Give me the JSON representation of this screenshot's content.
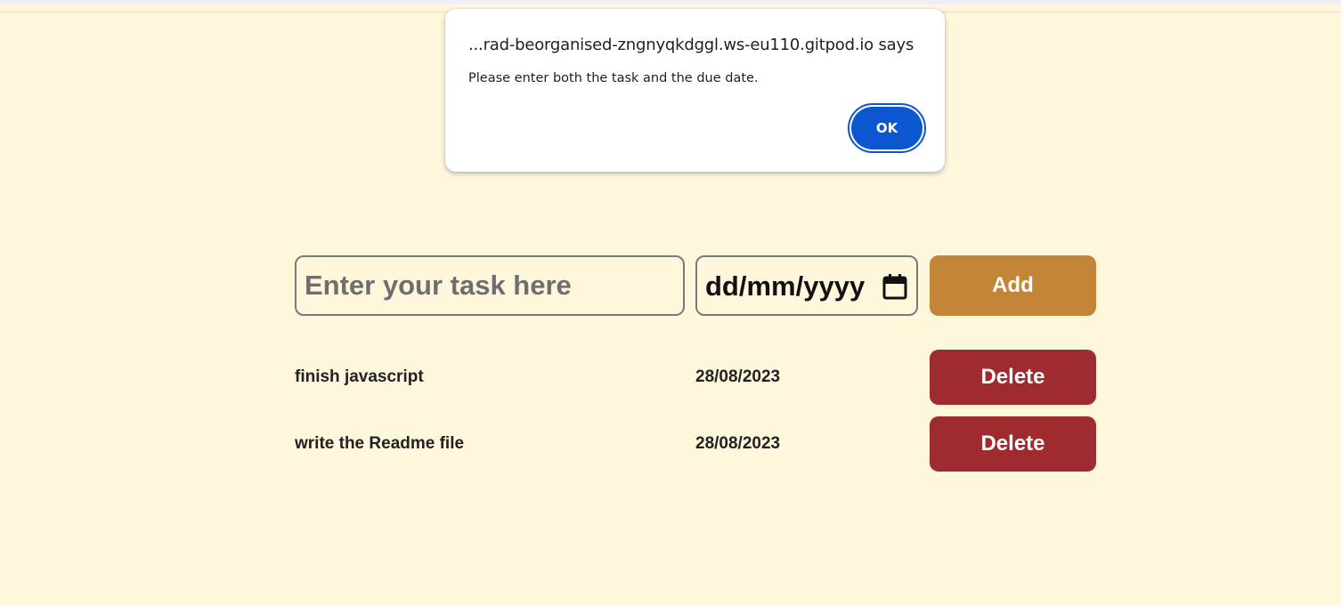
{
  "alert": {
    "title": "...rad-beorganised-zngnyqkdggl.ws-eu110.gitpod.io says",
    "message": "Please enter both the task and the due date.",
    "ok_label": "OK"
  },
  "form": {
    "task_placeholder": "Enter your task here",
    "task_value": "",
    "date_value": "dd/mm/yyyy",
    "add_label": "Add"
  },
  "tasks": [
    {
      "name": "finish javascript",
      "due": "28/08/2023",
      "delete_label": "Delete"
    },
    {
      "name": "write the Readme file",
      "due": "28/08/2023",
      "delete_label": "Delete"
    }
  ],
  "colors": {
    "background": "#fff7dc",
    "add_button": "#c38639",
    "delete_button": "#9e2c2f",
    "dialog_accent": "#0b57d0"
  },
  "icons": {
    "calendar": "calendar-icon"
  }
}
